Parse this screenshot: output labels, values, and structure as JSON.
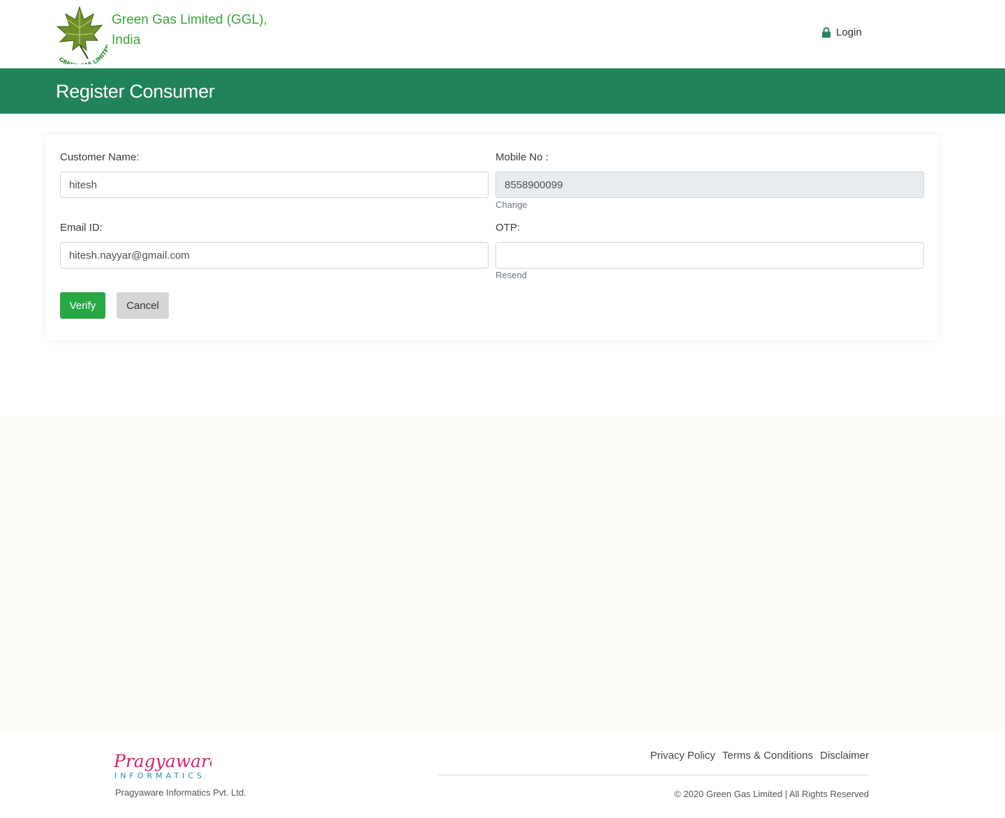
{
  "header": {
    "logo_text": "GREEN GAS LIMITED",
    "brand_line1": "Green Gas Limited (GGL),",
    "brand_line2": "India",
    "login_label": "Login"
  },
  "page": {
    "title": "Register Consumer"
  },
  "form": {
    "customer_name_label": "Customer Name:",
    "customer_name_value": "hitesh",
    "mobile_label": "Mobile No :",
    "mobile_value": "8558900099",
    "change_label": "Change",
    "email_label": "Email ID:",
    "email_value": "hitesh.nayyar@gmail.com",
    "otp_label": "OTP:",
    "otp_value": "",
    "resend_label": "Resend",
    "verify_label": "Verify",
    "cancel_label": "Cancel"
  },
  "footer": {
    "logo_script": "Pragyaware",
    "logo_sub": "INFORMATICS",
    "company": "Pragyaware Informatics Pvt. Ltd.",
    "links": [
      "Privacy Policy",
      "Terms & Conditions",
      "Disclaimer"
    ],
    "copyright": "© 2020 Green Gas Limited | All Rights Reserved"
  },
  "colors": {
    "brand_green": "#3aa53a",
    "titlebar_green": "#21835a",
    "verify_green": "#28a745",
    "pragyaware_pink": "#d9246e",
    "pragyaware_teal": "#1f8fa8"
  },
  "icons": {
    "login": "lock-icon",
    "logo": "maple-leaf-icon"
  }
}
